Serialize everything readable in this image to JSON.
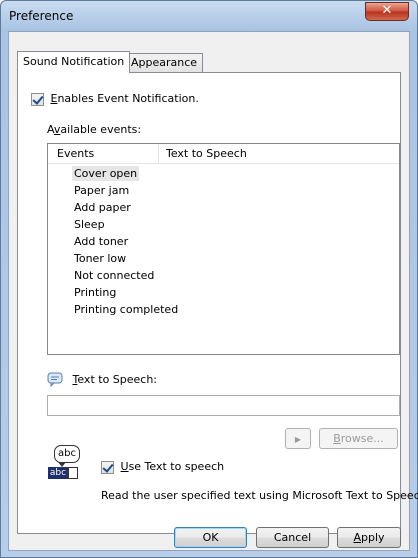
{
  "window": {
    "title": "Preference",
    "close_glyph": "✕"
  },
  "tabs": [
    {
      "label": "Sound Notification",
      "active": true
    },
    {
      "label": "Appearance",
      "active": false
    }
  ],
  "enable": {
    "prefix": "E",
    "rest": "nables Event Notification.",
    "checked": true
  },
  "available": {
    "pre": "A",
    "u": "v",
    "post": "ailable events:"
  },
  "list": {
    "columns": [
      "Events",
      "Text to Speech"
    ],
    "items": [
      "Cover open",
      "Paper jam",
      "Add paper",
      "Sleep",
      "Add toner",
      "Toner low",
      "Not connected",
      "Printing",
      "Printing completed"
    ],
    "selected_index": 0
  },
  "tts": {
    "prefix": "T",
    "rest": "ext to Speech:",
    "value": ""
  },
  "play_glyph": "▶",
  "browse": {
    "prefix": "B",
    "rest": "rowse..."
  },
  "abc_top": "abc",
  "abc_bottom": "abc",
  "use_tts": {
    "prefix": "U",
    "rest": "se Text to speech",
    "checked": true
  },
  "description": "Read the user specified text using Microsoft Text to Speech.",
  "buttons": {
    "ok": "OK",
    "cancel": "Cancel",
    "apply_prefix": "A",
    "apply_rest": "pply"
  },
  "colors": {
    "close": "#c9462c",
    "accent": "#3c7fb1"
  }
}
